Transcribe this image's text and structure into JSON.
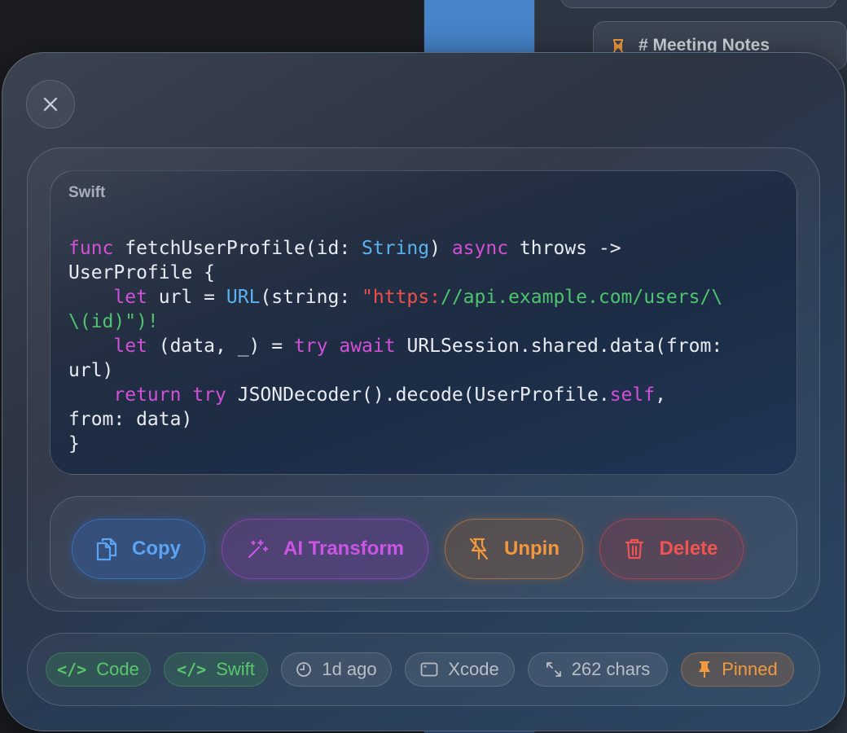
{
  "background": {
    "card_title": "# Meeting Notes"
  },
  "code": {
    "language": "Swift",
    "lines": [
      [
        {
          "t": "func",
          "c": "kw"
        },
        {
          "t": " fetchUserProfile(id: ",
          "c": ""
        },
        {
          "t": "String",
          "c": "ty"
        },
        {
          "t": ") ",
          "c": ""
        },
        {
          "t": "async",
          "c": "kw"
        },
        {
          "t": " throws ->",
          "c": ""
        }
      ],
      [
        {
          "t": "UserProfile {",
          "c": ""
        }
      ],
      [
        {
          "t": "    ",
          "c": ""
        },
        {
          "t": "let",
          "c": "kw"
        },
        {
          "t": " url = ",
          "c": ""
        },
        {
          "t": "URL",
          "c": "ty"
        },
        {
          "t": "(string: ",
          "c": ""
        },
        {
          "t": "\"https:",
          "c": "st-r"
        },
        {
          "t": "//api.example.com/users/\\",
          "c": "st-g"
        }
      ],
      [
        {
          "t": "\\(id)\")!",
          "c": "st-g"
        }
      ],
      [
        {
          "t": "    ",
          "c": ""
        },
        {
          "t": "let",
          "c": "kw"
        },
        {
          "t": " (data, _) = ",
          "c": ""
        },
        {
          "t": "try",
          "c": "kw"
        },
        {
          "t": " ",
          "c": ""
        },
        {
          "t": "await",
          "c": "kw"
        },
        {
          "t": " URLSession.shared.data(from:",
          "c": ""
        }
      ],
      [
        {
          "t": "url)",
          "c": ""
        }
      ],
      [
        {
          "t": "    ",
          "c": ""
        },
        {
          "t": "return",
          "c": "kw"
        },
        {
          "t": " ",
          "c": ""
        },
        {
          "t": "try",
          "c": "kw"
        },
        {
          "t": " JSONDecoder().decode(UserProfile.",
          "c": ""
        },
        {
          "t": "self",
          "c": "kw"
        },
        {
          "t": ",",
          "c": ""
        }
      ],
      [
        {
          "t": "from: data)",
          "c": ""
        }
      ],
      [
        {
          "t": "}",
          "c": ""
        }
      ]
    ]
  },
  "actions": {
    "copy": "Copy",
    "ai_transform": "AI Transform",
    "unpin": "Unpin",
    "delete": "Delete"
  },
  "meta": {
    "type": "Code",
    "language": "Swift",
    "time": "1d ago",
    "app": "Xcode",
    "size": "262 chars",
    "status": "Pinned"
  },
  "colors": {
    "keyword": "#d24fd7",
    "type": "#5ab3f0",
    "string_red": "#f0504a",
    "string_green": "#4fc46e"
  }
}
